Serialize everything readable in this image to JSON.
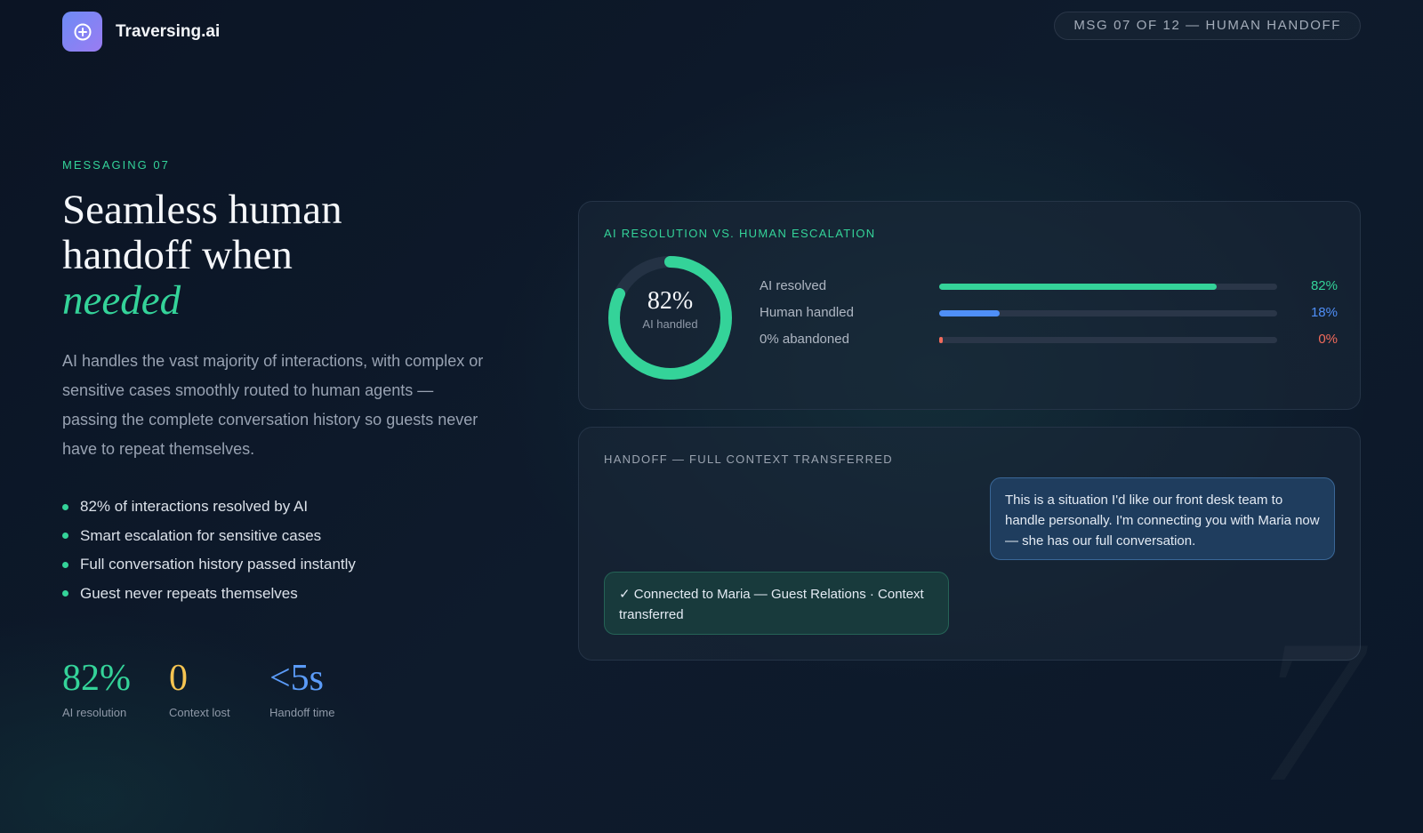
{
  "brand": {
    "name": "Traversing.ai",
    "icon": "plus-circle-icon"
  },
  "progress_pill": "MSG 07 OF 12 — HUMAN HANDOFF",
  "eyebrow": "MESSAGING 07",
  "headline": {
    "line1": "Seamless human",
    "line2": "handoff when",
    "emphasis": "needed"
  },
  "lead": "AI handles the vast majority of interactions, with complex or sensitive cases smoothly routed to human agents — passing the complete conversation history so guests never have to repeat themselves.",
  "bullets": [
    "82% of interactions resolved by AI",
    "Smart escalation for sensitive cases",
    "Full conversation history passed instantly",
    "Guest never repeats themselves"
  ],
  "stats": [
    {
      "value": "82%",
      "label": "AI resolution",
      "color": "#34d399"
    },
    {
      "value": "0",
      "label": "Context lost",
      "color": "#f5c451"
    },
    {
      "value": "<5s",
      "label": "Handoff time",
      "color": "#5b9bf8"
    }
  ],
  "resolution_card": {
    "title": "AI RESOLUTION VS. HUMAN ESCALATION",
    "donut": {
      "value": "82%",
      "label": "AI handled",
      "fraction": 0.82,
      "color": "#34d399",
      "track": "#243244"
    },
    "bars": [
      {
        "label": "AI resolved",
        "value": "82%",
        "fraction": 0.82,
        "color": "#34d399"
      },
      {
        "label": "Human handled",
        "value": "18%",
        "fraction": 0.18,
        "color": "#4f8ff7"
      },
      {
        "label": "0% abandoned",
        "value": "0%",
        "fraction": 0.01,
        "color": "#f26b5b"
      }
    ]
  },
  "handoff_card": {
    "title": "HANDOFF — FULL CONTEXT TRANSFERRED",
    "ai_message": "This is a situation I'd like our front desk team to handle personally. I'm connecting you with Maria now — she has our full conversation.",
    "system_message": "✓ Connected to Maria — Guest Relations · Context transferred"
  },
  "watermark": "7"
}
